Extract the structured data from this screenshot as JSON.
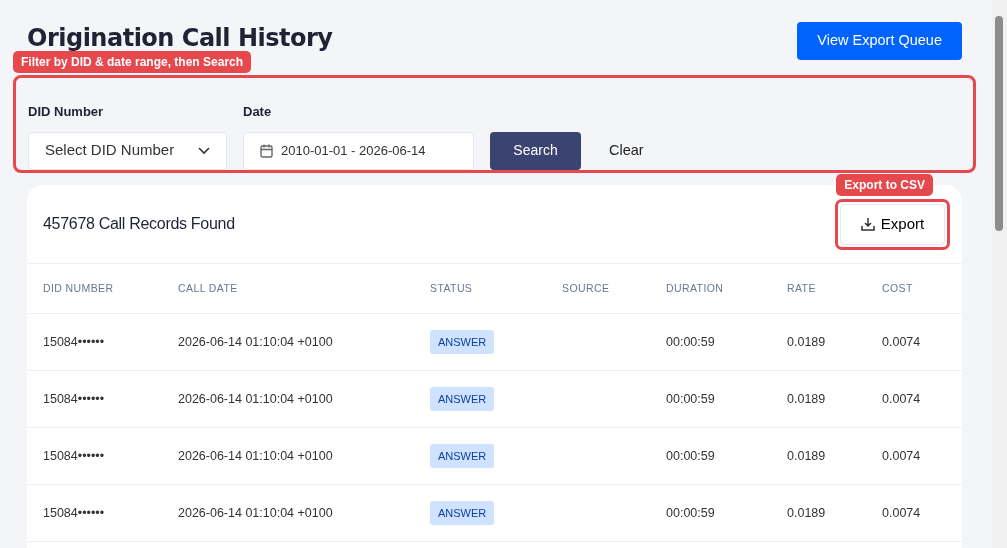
{
  "page": {
    "title": "Origination Call History",
    "export_queue_button": "View Export Queue"
  },
  "filters": {
    "annotation": "Filter by DID & date range, then Search",
    "did_label": "DID Number",
    "did_placeholder": "Select DID Number",
    "date_label": "Date",
    "date_value": "2010-01-01 - 2026-06-14",
    "search_button": "Search",
    "clear_button": "Clear"
  },
  "results": {
    "annotation": "Export to CSV",
    "count_text": "457678 Call Records Found",
    "export_button": "Export"
  },
  "table": {
    "columns": [
      "DID NUMBER",
      "CALL DATE",
      "STATUS",
      "SOURCE",
      "DURATION",
      "RATE",
      "COST"
    ],
    "rows": [
      {
        "did": "15084••••••",
        "call_date": "2026-06-14 01:10:04 +0100",
        "status": "ANSWER",
        "duration": "00:00:59",
        "rate": "0.0189",
        "cost": "0.0074"
      },
      {
        "did": "15084••••••",
        "call_date": "2026-06-14 01:10:04 +0100",
        "status": "ANSWER",
        "duration": "00:00:59",
        "rate": "0.0189",
        "cost": "0.0074"
      },
      {
        "did": "15084••••••",
        "call_date": "2026-06-14 01:10:04 +0100",
        "status": "ANSWER",
        "duration": "00:00:59",
        "rate": "0.0189",
        "cost": "0.0074"
      },
      {
        "did": "15084••••••",
        "call_date": "2026-06-14 01:10:04 +0100",
        "status": "ANSWER",
        "duration": "00:00:59",
        "rate": "0.0189",
        "cost": "0.0074"
      }
    ]
  }
}
